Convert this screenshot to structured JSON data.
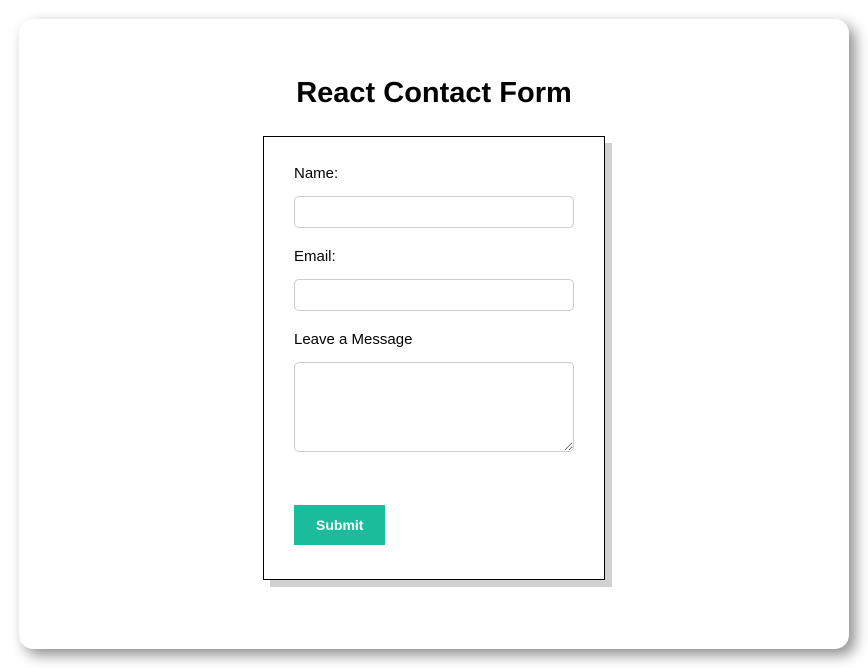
{
  "header": {
    "title": "React Contact Form"
  },
  "form": {
    "name_label": "Name:",
    "name_value": "",
    "email_label": "Email:",
    "email_value": "",
    "message_label": "Leave a Message",
    "message_value": "",
    "submit_label": "Submit"
  },
  "colors": {
    "accent": "#1abc9c"
  }
}
